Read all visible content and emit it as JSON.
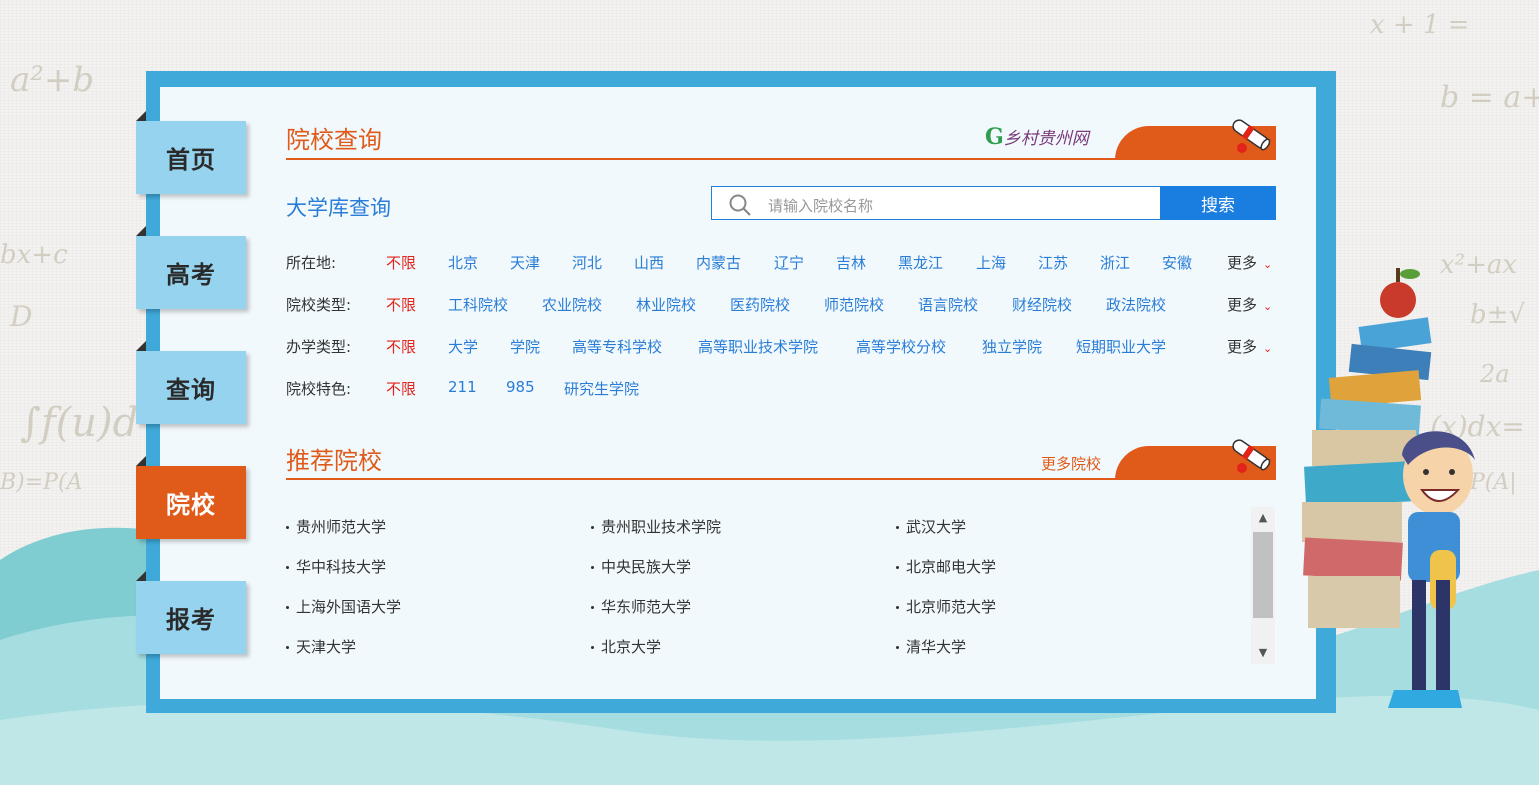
{
  "nav": {
    "tabs": [
      {
        "label": "首页"
      },
      {
        "label": "高考"
      },
      {
        "label": "查询"
      },
      {
        "label": "院校"
      },
      {
        "label": "报考"
      }
    ],
    "active_index": 3
  },
  "header": {
    "title": "院校查询",
    "logo_text": "乡村贵州网"
  },
  "search": {
    "heading": "大学库查询",
    "placeholder": "请输入院校名称",
    "button_label": "搜索"
  },
  "filters": [
    {
      "label": "所在地:",
      "options": [
        "不限",
        "北京",
        "天津",
        "河北",
        "山西",
        "内蒙古",
        "辽宁",
        "吉林",
        "黑龙江",
        "上海",
        "江苏",
        "浙江",
        "安徽"
      ],
      "selected": "不限",
      "more": "更多"
    },
    {
      "label": "院校类型:",
      "options": [
        "不限",
        "工科院校",
        "农业院校",
        "林业院校",
        "医药院校",
        "师范院校",
        "语言院校",
        "财经院校",
        "政法院校"
      ],
      "selected": "不限",
      "more": "更多"
    },
    {
      "label": "办学类型:",
      "options": [
        "不限",
        "大学",
        "学院",
        "高等专科学校",
        "高等职业技术学院",
        "高等学校分校",
        "独立学院",
        "短期职业大学"
      ],
      "selected": "不限",
      "more": "更多"
    },
    {
      "label": "院校特色:",
      "options": [
        "不限",
        "211",
        "985",
        "研究生学院"
      ],
      "selected": "不限"
    }
  ],
  "recommend": {
    "title": "推荐院校",
    "more_label": "更多院校",
    "schools": [
      "贵州师范大学",
      "贵州职业技术学院",
      "武汉大学",
      "华中科技大学",
      "中央民族大学",
      "北京邮电大学",
      "上海外国语大学",
      "华东师范大学",
      "北京师范大学",
      "天津大学",
      "北京大学",
      "清华大学"
    ]
  },
  "colors": {
    "accent_orange": "#e05a19",
    "link_blue": "#2a7dd6",
    "frame_blue": "#3fa9d9",
    "tab_blue": "#96d3ef",
    "selected_red": "#e2231a",
    "search_button": "#1a7de0"
  }
}
